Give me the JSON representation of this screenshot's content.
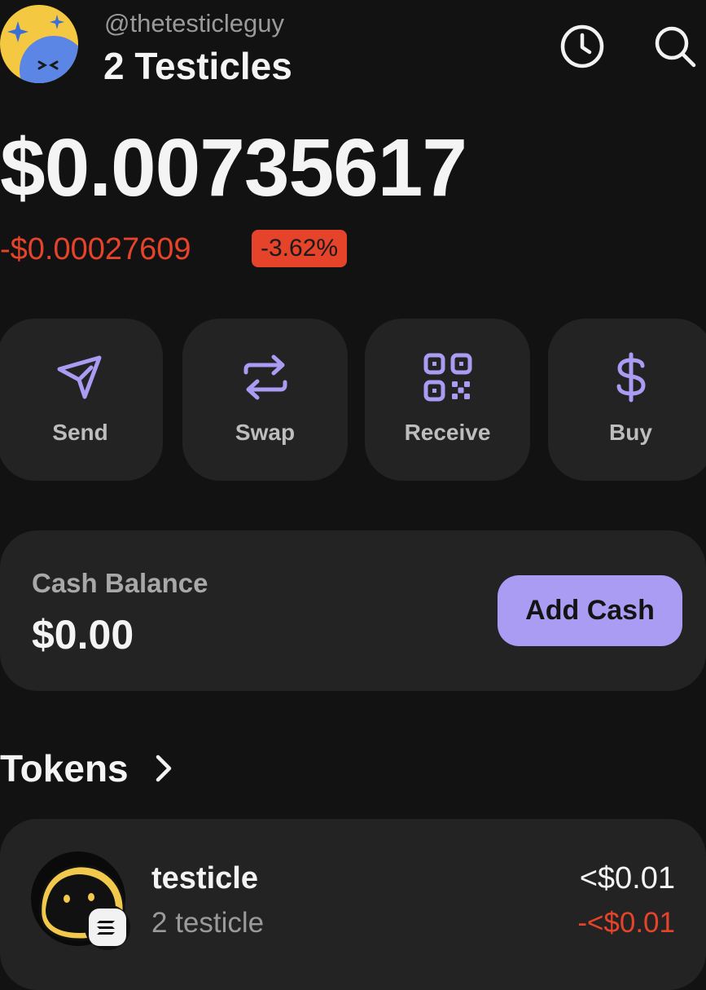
{
  "profile": {
    "handle": "@thetesticleguy",
    "display_name": "2 Testicles",
    "avatar_icon": "emoji-face-avatar"
  },
  "header": {
    "history_icon": "clock-icon",
    "search_icon": "search-icon"
  },
  "balance": {
    "value": "$0.00735617",
    "change_amount": "-$0.00027609",
    "change_percent": "-3.62%"
  },
  "actions": [
    {
      "label": "Send",
      "icon": "send-icon"
    },
    {
      "label": "Swap",
      "icon": "swap-icon"
    },
    {
      "label": "Receive",
      "icon": "qr-code-icon"
    },
    {
      "label": "Buy",
      "icon": "dollar-icon"
    }
  ],
  "cash": {
    "title": "Cash Balance",
    "value": "$0.00",
    "button_label": "Add Cash"
  },
  "tokens": {
    "heading": "Tokens",
    "items": [
      {
        "name": "testicle",
        "amount": "2 testicle",
        "value": "<$0.01",
        "change": "-<$0.01"
      }
    ]
  },
  "colors": {
    "background": "#121212",
    "card": "#232323",
    "accent": "#aa9bf3",
    "negative": "#e5432a"
  }
}
